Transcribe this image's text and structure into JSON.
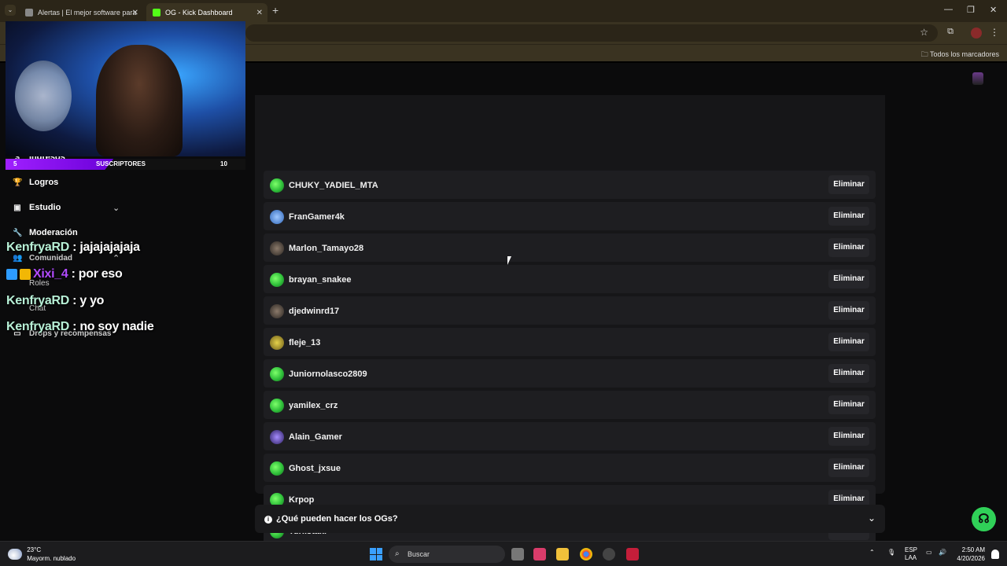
{
  "browser": {
    "tabs": [
      {
        "title": "Alertas | El mejor software para"
      },
      {
        "title": "OG - Kick Dashboard"
      }
    ],
    "bookmarks_label": "Todos los marcadores"
  },
  "sidebar": {
    "ingresos": "Ingresos",
    "logros": "Logros",
    "estudio": "Estudio",
    "moderacion": "Moderación",
    "comunidad": "Comunidad",
    "roles": "Roles",
    "chat": "Chat",
    "drops": "Drops y recompensas"
  },
  "stream_overlay": {
    "sub_left": "5",
    "sub_label": "SUSCRIPTORES",
    "sub_right": "10",
    "messages": [
      {
        "user": "KenfryaRD",
        "text": " : jajajajajaja"
      },
      {
        "user": "Xixi_4",
        "text": " : por eso"
      },
      {
        "user": "KenfryaRD",
        "text": " : y yo"
      },
      {
        "user": "KenfryaRD",
        "text": " : no soy nadie"
      }
    ]
  },
  "og_list": {
    "delete_label": "Eliminar",
    "users": [
      {
        "name": "CHUKY_YADIEL_MTA",
        "avatar": "green"
      },
      {
        "name": "FranGamer4k",
        "avatar": "blue"
      },
      {
        "name": "Marlon_Tamayo28",
        "avatar": "dark"
      },
      {
        "name": "brayan_snakee",
        "avatar": "green"
      },
      {
        "name": "djedwinrd17",
        "avatar": "dark"
      },
      {
        "name": "fleje_13",
        "avatar": "gold"
      },
      {
        "name": "Juniornolasco2809",
        "avatar": "green"
      },
      {
        "name": "yamilex_crz",
        "avatar": "green"
      },
      {
        "name": "Alain_Gamer",
        "avatar": "purple"
      },
      {
        "name": "Ghost_jxsue",
        "avatar": "green"
      },
      {
        "name": "Krpop",
        "avatar": "green"
      },
      {
        "name": "Turiistakr",
        "avatar": "green"
      }
    ]
  },
  "faq": {
    "question": "¿Qué pueden hacer los OGs?"
  },
  "taskbar": {
    "temp": "23°C",
    "weather": "Mayorm. nublado",
    "search_placeholder": "Buscar",
    "lang1": "ESP",
    "lang2": "LAA",
    "time": "2:50 AM",
    "date": "4/20/2026"
  },
  "colors": {
    "accent": "#30d158",
    "sub_bar": "#a020ff",
    "chat_name": "#b7f0d6",
    "chat_name_alt": "#b14bff"
  }
}
